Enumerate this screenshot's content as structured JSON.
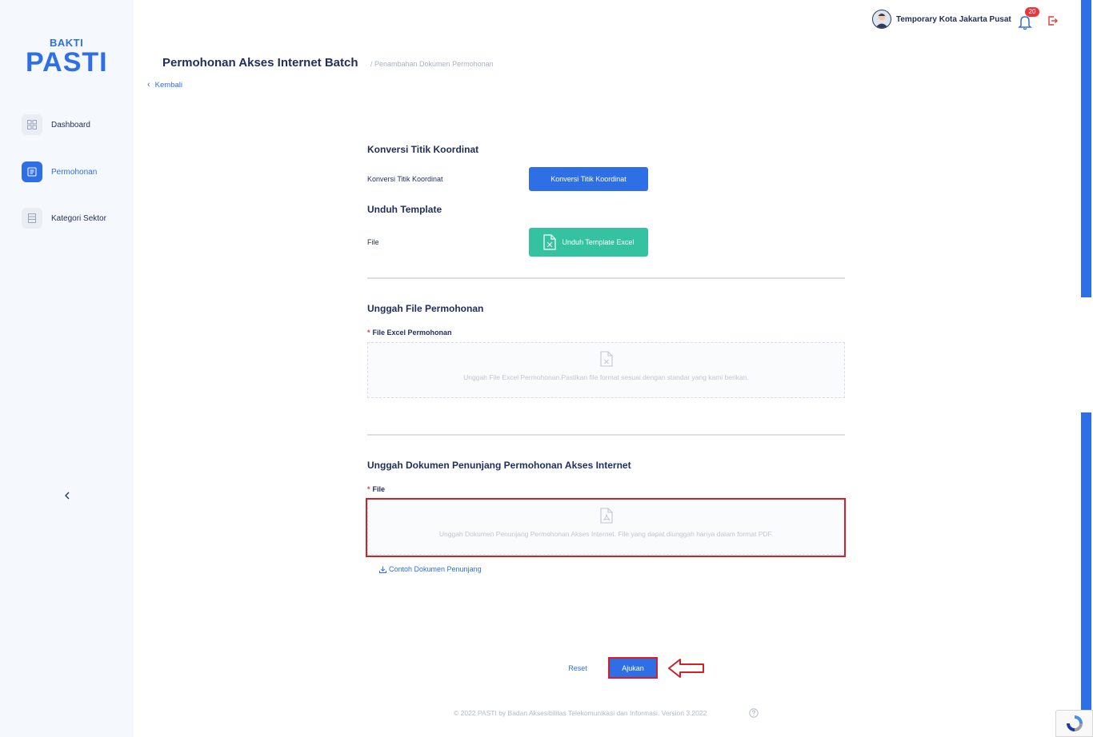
{
  "brand": {
    "top": "BAKTI",
    "main": "PASTI",
    "color": "#2e6fe6"
  },
  "sidebar": {
    "items": [
      {
        "label": "Dashboard",
        "icon": "grid-icon",
        "active": false
      },
      {
        "label": "Permohonan",
        "icon": "document-icon",
        "active": true
      },
      {
        "label": "Kategori Sektor",
        "icon": "list-icon",
        "active": false
      }
    ]
  },
  "header": {
    "user_name": "Temporary Kota Jakarta Pusat",
    "notification_count": "20"
  },
  "page": {
    "title": "Permohonan Akses Internet Batch",
    "breadcrumb": "/ Penambahan Dokumen Permohonan",
    "back_label": "Kembali"
  },
  "form": {
    "convert": {
      "section_title": "Konversi Titik Koordinat",
      "label": "Konversi Titik Koordinat",
      "button": "Konversi Titik Koordinat"
    },
    "template": {
      "section_title": "Unduh Template",
      "label": "File",
      "button": "Unduh Template Excel"
    },
    "upload_excel": {
      "section_title": "Unggah File Permohonan",
      "label": "File Excel Permohonan",
      "hint": "Unggah File Excel Permohonan.Pastikan file format sesuai dengan standar yang kami berikan."
    },
    "upload_support": {
      "section_title": "Unggah Dokumen Penunjang Permohonan Akses Internet",
      "label": "File",
      "hint": "Unggah Dokumen Penunjang Permohonan Akses Internet. File yang dapat diunggah hanya dalam format PDF.",
      "sample_link": "Contoh Dokumen Penunjang"
    },
    "reset_label": "Reset",
    "submit_label": "Ajukan"
  },
  "footer": {
    "text": "© 2022 PASTI by Badan Aksesibilitas Telekomunikasi dan Informasi. Version 3.2022"
  },
  "colors": {
    "primary": "#2e6fe6",
    "success": "#35c2a0",
    "danger": "#e8363a",
    "annotation": "#d0202a"
  }
}
